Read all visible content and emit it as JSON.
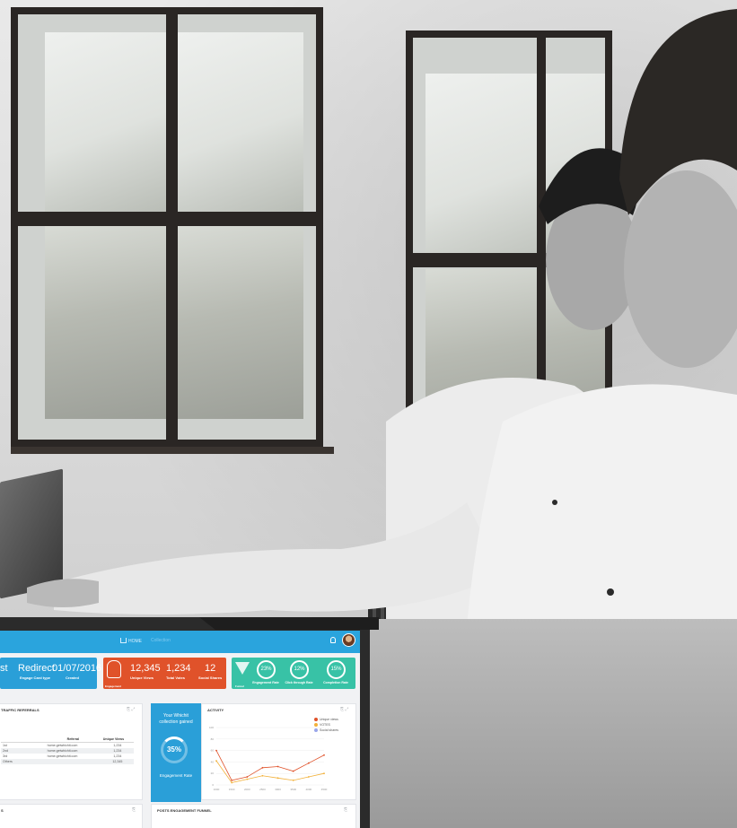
{
  "topbar": {
    "home_label": "HOME",
    "crumb_label": "Collection"
  },
  "summary_cards": {
    "blue": {
      "col1_value": "st",
      "col2_value": "Redirect",
      "col2_caption": "Engage Card type",
      "col3_value": "01/07/2016",
      "col3_caption": "Created"
    },
    "red": {
      "footer": "Engagement",
      "stats": [
        {
          "value": "12,345",
          "caption": "Unique Views"
        },
        {
          "value": "1,234",
          "caption": "Total Votes"
        },
        {
          "value": "12",
          "caption": "Social Shares"
        }
      ]
    },
    "green": {
      "footer": "Funnel",
      "rings": [
        {
          "value": "23%",
          "caption": "Engagement Rate"
        },
        {
          "value": "12%",
          "caption": "Click through Rate"
        },
        {
          "value": "15%",
          "caption": "Completion Rate"
        }
      ]
    }
  },
  "traffic_panel": {
    "title": "TRAFFIC REFERRALS",
    "columns": [
      "",
      "Referral",
      "Unique Views"
    ],
    "rows": [
      [
        "1st",
        "home.getwhichit.com",
        "1,234"
      ],
      [
        "2nd",
        "home.getwhichit.com",
        "1,234"
      ],
      [
        "3rd",
        "home.getwhichit.com",
        "1,234"
      ],
      [
        "Others",
        "",
        "12,345"
      ]
    ]
  },
  "engagement_box": {
    "text": "Your Whichit collection gained",
    "percent": "35%",
    "rate_label": "Engagement Rate"
  },
  "activity_panel": {
    "title": "ACTIVITY",
    "legend": [
      {
        "label": "Unique views",
        "color": "#e0522a"
      },
      {
        "label": "VOTES",
        "color": "#f2b13a"
      },
      {
        "label": "Social shares",
        "color": "#9aa6ea"
      }
    ]
  },
  "bottom_left_panel": {
    "title": "S"
  },
  "funnel_panel": {
    "title": "POSTS ENGAGEMENT FUNNEL"
  },
  "chart_data": {
    "type": "line",
    "title": "ACTIVITY",
    "x": [
      "1000",
      "1500",
      "2000",
      "2500",
      "3000",
      "3500",
      "4000",
      "4500"
    ],
    "series": [
      {
        "name": "Unique views",
        "color": "#e0522a",
        "values": [
          60,
          8,
          14,
          30,
          32,
          24,
          38,
          52
        ]
      },
      {
        "name": "VOTES",
        "color": "#f2b13a",
        "values": [
          42,
          4,
          10,
          16,
          12,
          8,
          14,
          20
        ]
      }
    ],
    "yticks": [
      "100",
      "80",
      "60",
      "40",
      "20",
      "0"
    ],
    "ylim": [
      0,
      100
    ]
  }
}
